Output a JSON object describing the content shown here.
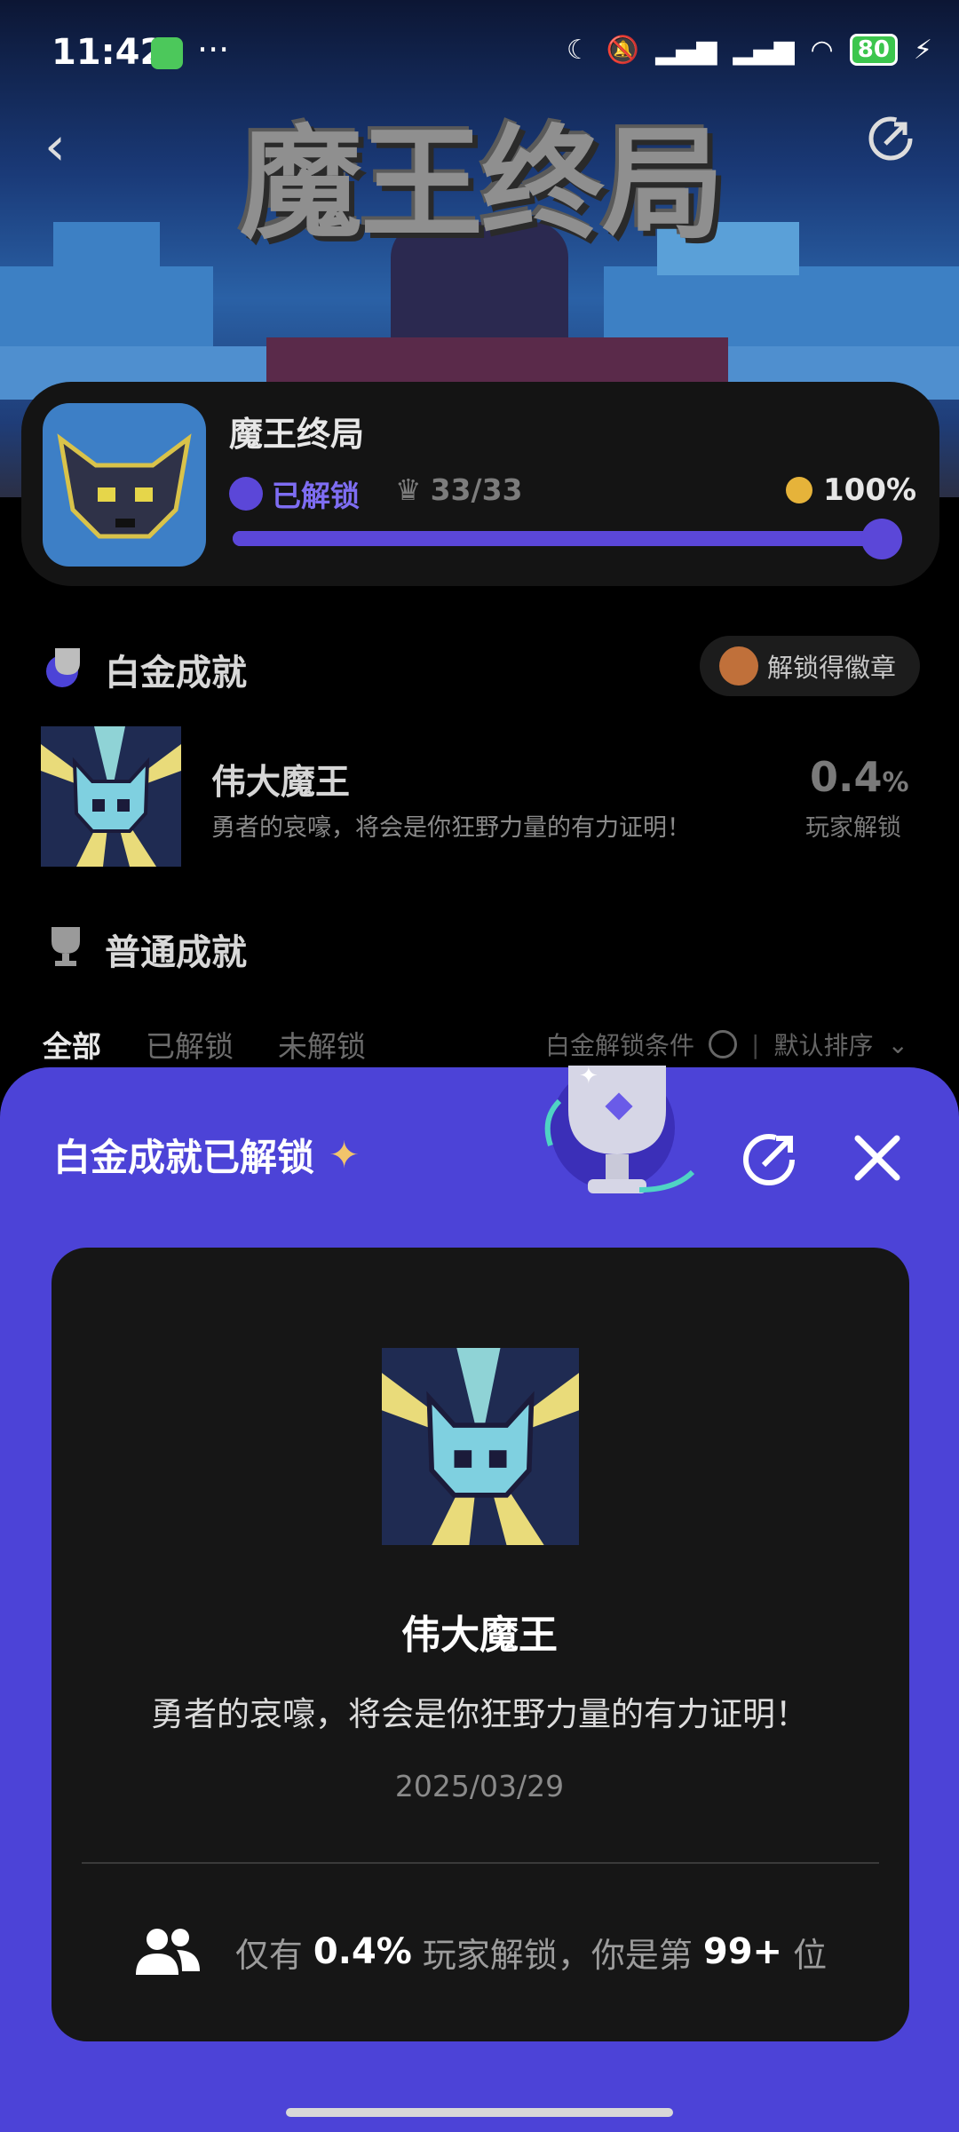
{
  "status": {
    "time": "11:42",
    "dots": "···",
    "battery": "80"
  },
  "banner": {
    "logo": "魔王终局"
  },
  "game": {
    "title": "魔王终局",
    "unlock_label": "已解锁",
    "count": "33/33",
    "percent": "100%",
    "progress": 1.0
  },
  "platinum": {
    "section_title": "白金成就",
    "badge_button": "解锁得徽章",
    "name": "伟大魔王",
    "desc": "勇者的哀嚎，将会是你狂野力量的有力证明！",
    "pct": "0.4",
    "pct_unit": "%",
    "pct_label": "玩家解锁"
  },
  "normal": {
    "section_title": "普通成就",
    "filters": [
      "全部",
      "已解锁",
      "未解锁"
    ],
    "filter_condition": "白金解锁条件",
    "sort": "默认排序"
  },
  "sheet": {
    "title": "白金成就已解锁",
    "name": "伟大魔王",
    "desc": "勇者的哀嚎，将会是你狂野力量的有力证明！",
    "date": "2025/03/29",
    "stat_prefix": "仅有",
    "stat_pct": "0.4%",
    "stat_mid": "玩家解锁，你是第",
    "stat_rank": "99+",
    "stat_suffix": "位"
  }
}
